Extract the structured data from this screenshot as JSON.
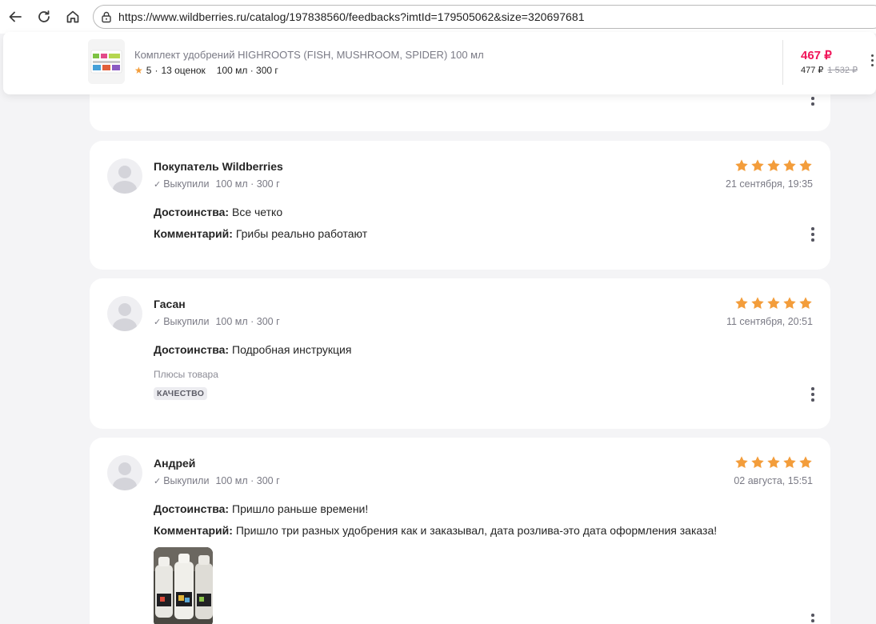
{
  "browser": {
    "url": "https://www.wildberries.ru/catalog/197838560/feedbacks?imtId=179505062&size=320697681"
  },
  "product": {
    "title": "Комплект удобрений HIGHROOTS (FISH, MUSHROOM, SPIDER) 100 мл",
    "rating": "5",
    "reviews_count": "13 оценок",
    "variant": "100 мл · 300 г",
    "price": "467 ₽",
    "price_wallet": "477 ₽",
    "price_old": "1 532 ₽"
  },
  "colors": {
    "star": "#f39d3b",
    "price": "#f0165a"
  },
  "reviews": [
    {
      "author": "Покупатель Wildberries",
      "status": "Выкупили",
      "variant": "100 мл · 300 г",
      "stars": 5,
      "date": "21 сентября, 19:35",
      "pros_label": "Достоинства:",
      "pros": "Все четко",
      "comment_label": "Комментарий:",
      "comment": "Грибы реально работают"
    },
    {
      "author": "Гасан",
      "status": "Выкупили",
      "variant": "100 мл · 300 г",
      "stars": 5,
      "date": "11 сентября, 20:51",
      "pros_label": "Достоинства:",
      "pros": "Подробная инструкция",
      "features_label": "Плюсы товара",
      "tag": "КАЧЕСТВО"
    },
    {
      "author": "Андрей",
      "status": "Выкупили",
      "variant": "100 мл · 300 г",
      "stars": 5,
      "date": "02 августа, 15:51",
      "pros_label": "Достоинства:",
      "pros": "Пришло раньше времени!",
      "comment_label": "Комментарий:",
      "comment": "Пришло три разных удобрения как и заказывал, дата розлива-это дата оформления заказа!"
    }
  ]
}
